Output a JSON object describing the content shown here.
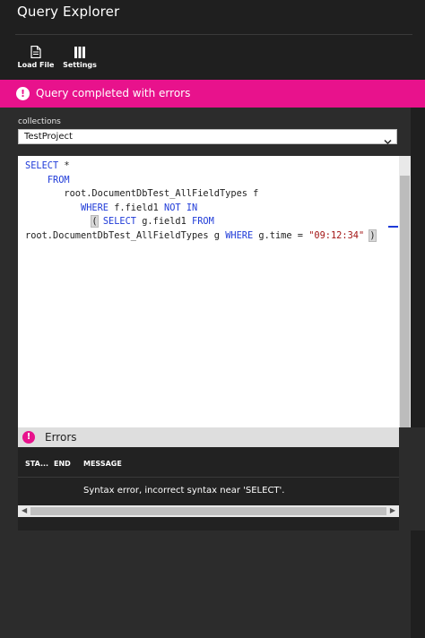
{
  "app": {
    "title": "Query Explorer"
  },
  "toolbar": {
    "load_file_label": "Load File",
    "settings_label": "Settings"
  },
  "banner": {
    "message": "Query completed with errors",
    "color": "#e8128c"
  },
  "collections": {
    "label": "collections",
    "selected": "TestProject"
  },
  "editor": {
    "lines": [
      "SELECT *",
      "FROM",
      "root.DocumentDbTest_AllFieldTypes f",
      "WHERE f.field1 NOT IN",
      "( SELECT g.field1 FROM",
      "root.DocumentDbTest_AllFieldTypes g WHERE g.time = \"09:12:34\" )"
    ]
  },
  "errors": {
    "title": "Errors",
    "columns": [
      "STA...",
      "END",
      "MESSAGE"
    ],
    "rows": [
      {
        "start": "",
        "end": "",
        "message": "Syntax error, incorrect syntax near 'SELECT'."
      }
    ]
  },
  "icons": {
    "load_file": "document-icon",
    "settings": "columns-icon",
    "banner": "exclamation-icon",
    "select": "chevron-down-icon"
  }
}
